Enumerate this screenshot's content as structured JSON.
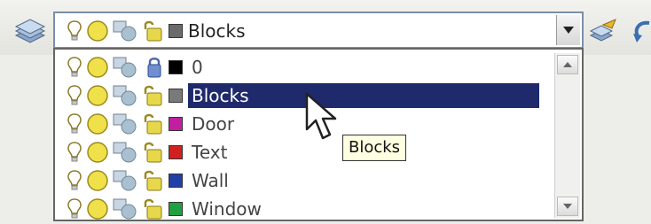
{
  "combo": {
    "selected": "Blocks",
    "swatch_color": "#6b6b6b"
  },
  "layers": [
    {
      "name": "0",
      "color": "#000000",
      "lock": "locked",
      "swatch_name": "black-swatch"
    },
    {
      "name": "Blocks",
      "color": "#7a7a7a",
      "lock": "unlocked",
      "swatch_name": "gray-swatch",
      "selected": true
    },
    {
      "name": "Door",
      "color": "#c020a0",
      "lock": "unlocked",
      "swatch_name": "magenta-swatch"
    },
    {
      "name": "Text",
      "color": "#d02020",
      "lock": "unlocked",
      "swatch_name": "red-swatch"
    },
    {
      "name": "Wall",
      "color": "#2040a8",
      "lock": "unlocked",
      "swatch_name": "blue-swatch"
    },
    {
      "name": "Window",
      "color": "#20a040",
      "lock": "unlocked",
      "swatch_name": "green-swatch"
    }
  ],
  "tooltip": "Blocks",
  "colors": {
    "selection_bg": "#1e2a6b",
    "tooltip_bg": "#ffffe1"
  }
}
